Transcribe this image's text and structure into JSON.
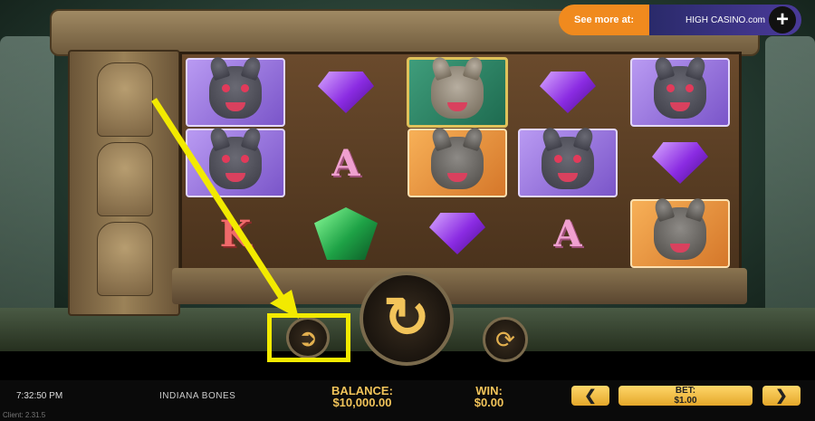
{
  "promo": {
    "see_more": "See more at:",
    "brand_high": "HIGH",
    "brand_casino": "CASINO.com",
    "plus_label": "+"
  },
  "reels": {
    "columns": [
      [
        {
          "symbol": "bat-dog"
        },
        {
          "symbol": "bat-dog"
        },
        {
          "symbol": "K"
        }
      ],
      [
        {
          "symbol": "purple-gem"
        },
        {
          "symbol": "A"
        },
        {
          "symbol": "green-gem"
        }
      ],
      [
        {
          "symbol": "wolf-wild"
        },
        {
          "symbol": "blue-cap-dog"
        },
        {
          "symbol": "purple-gem"
        }
      ],
      [
        {
          "symbol": "purple-gem"
        },
        {
          "symbol": "bat-dog"
        },
        {
          "symbol": "A"
        }
      ],
      [
        {
          "symbol": "bat-dog"
        },
        {
          "symbol": "purple-gem"
        },
        {
          "symbol": "blue-cap-dog"
        }
      ]
    ]
  },
  "letters": {
    "a": "A",
    "k": "K"
  },
  "controls": {
    "spin_icon": "↻",
    "autoplay_icon": "⟳",
    "turbo_icon": "➲"
  },
  "status": {
    "time": "7:32:50 PM",
    "game_name": "INDIANA BONES",
    "client": "Client: 2.31.5",
    "balance_label": "BALANCE:",
    "balance_value": "$10,000.00",
    "win_label": "WIN:",
    "win_value": "$0.00",
    "bet_label": "BET:",
    "bet_value": "$1.00",
    "bet_decrease": "❮",
    "bet_increase": "❯"
  },
  "colors": {
    "accent": "#f2c45a",
    "highlight": "#f2ea00",
    "promo": "#f08a1e"
  }
}
